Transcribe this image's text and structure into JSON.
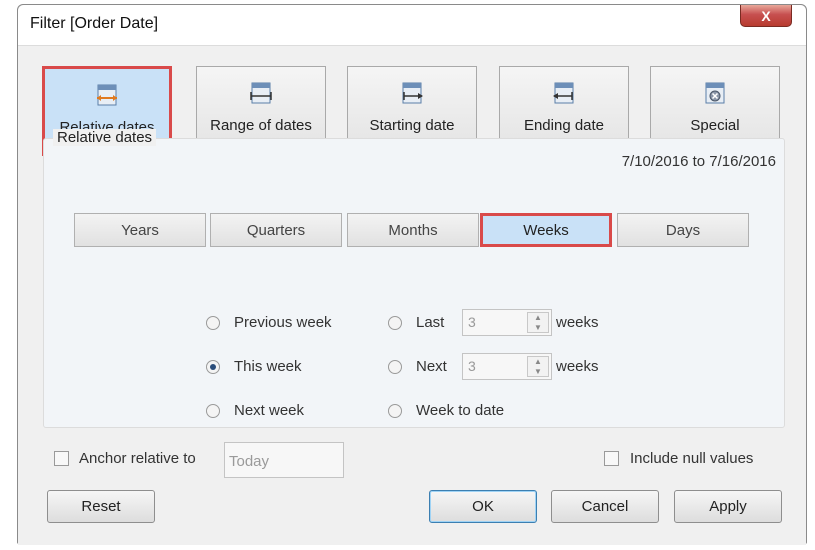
{
  "window": {
    "title": "Filter [Order Date]",
    "close_label": "X"
  },
  "filter_types": [
    {
      "label": "Relative dates",
      "icon": "relative-dates-icon",
      "selected": true
    },
    {
      "label": "Range of dates",
      "icon": "range-of-dates-icon",
      "selected": false
    },
    {
      "label": "Starting date",
      "icon": "starting-date-icon",
      "selected": false
    },
    {
      "label": "Ending date",
      "icon": "ending-date-icon",
      "selected": false
    },
    {
      "label": "Special",
      "icon": "special-icon",
      "selected": false
    }
  ],
  "group": {
    "legend": "Relative dates",
    "range_text": "7/10/2016 to 7/16/2016"
  },
  "periods": [
    {
      "label": "Years",
      "selected": false
    },
    {
      "label": "Quarters",
      "selected": false
    },
    {
      "label": "Months",
      "selected": false
    },
    {
      "label": "Weeks",
      "selected": true
    },
    {
      "label": "Days",
      "selected": false
    }
  ],
  "options": {
    "previous": "Previous week",
    "this": "This week",
    "next": "Next week",
    "last": "Last",
    "next_n": "Next",
    "to_date": "Week to date",
    "last_value": "3",
    "next_value": "3",
    "unit": "weeks",
    "selected": "this"
  },
  "anchor": {
    "label": "Anchor relative to",
    "value": "Today",
    "checked": false
  },
  "include_null": {
    "label": "Include null values",
    "checked": false
  },
  "buttons": {
    "reset": "Reset",
    "ok": "OK",
    "cancel": "Cancel",
    "apply": "Apply"
  },
  "colors": {
    "selected_fill": "#c9e1f7",
    "highlight_border": "#d94a4a"
  }
}
